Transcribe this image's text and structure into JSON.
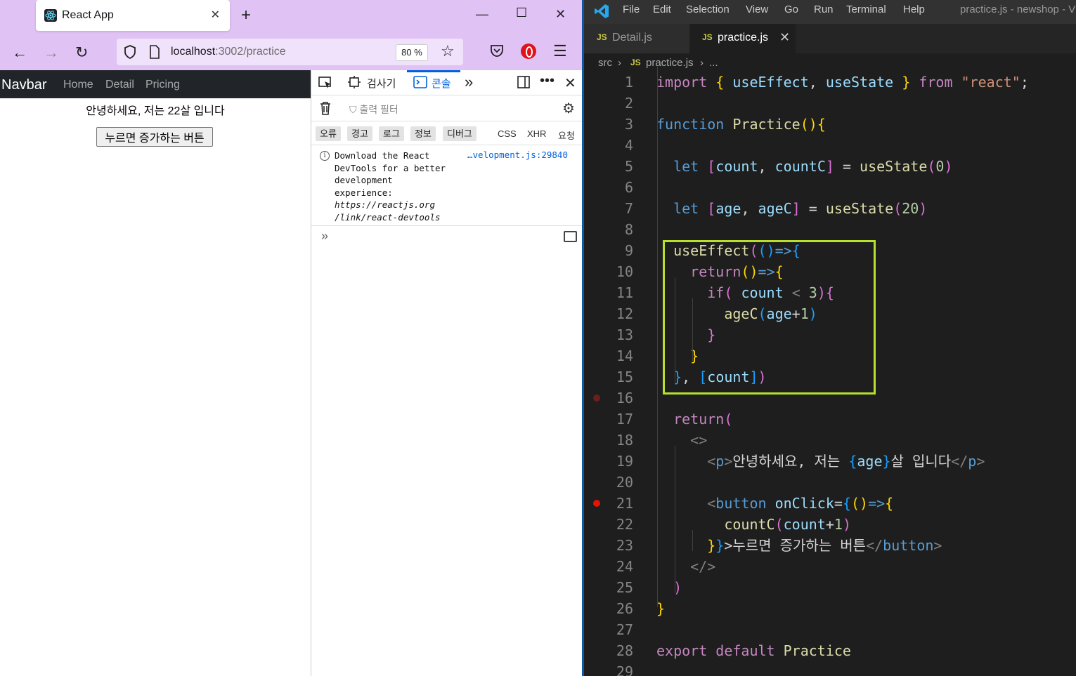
{
  "browser": {
    "tab_title": "React App",
    "url_host": "localhost",
    "url_rest": ":3002/practice",
    "zoom": "80 %"
  },
  "app": {
    "brand": "Navbar",
    "nav_links": [
      "Home",
      "Detail",
      "Pricing"
    ],
    "greeting": "안녕하세요, 저는 22살 입니다",
    "button_label": "누르면 증가하는 버튼"
  },
  "devtools": {
    "tabs": [
      "검사기",
      "콘솔"
    ],
    "filter_placeholder": "출력 필터",
    "levels": [
      "오류",
      "경고",
      "로그",
      "정보",
      "디버그"
    ],
    "extra_filters": [
      "CSS",
      "XHR",
      "요청"
    ],
    "message_lines": [
      "Download the React",
      "DevTools for a better",
      "development",
      "experience:",
      "https://reactjs.org",
      "/link/react-devtools"
    ],
    "message_source": "…velopment.js:29840"
  },
  "vscode": {
    "menu": [
      "File",
      "Edit",
      "Selection",
      "View",
      "Go",
      "Run",
      "Terminal",
      "Help"
    ],
    "window_title": "practice.js - newshop - Vi",
    "tabs": [
      {
        "icon": "JS",
        "name": "Detail.js"
      },
      {
        "icon": "JS",
        "name": "practice.js"
      }
    ],
    "breadcrumb": [
      "src",
      "JS",
      "practice.js",
      "..."
    ],
    "code_lines": [
      "import { useEffect, useState } from \"react\";",
      "",
      "function Practice(){",
      "",
      "  let [count, countC] = useState(0)",
      "",
      "  let [age, ageC] = useState(20)",
      "",
      "  useEffect(()=>{",
      "    return()=>{",
      "      if( count < 3){",
      "        ageC(age+1)",
      "      }",
      "    }",
      "  }, [count])",
      "",
      "  return(",
      "    <>",
      "      <p>안녕하세요, 저는 {age}살 입니다</p>",
      "",
      "      <button onClick={()=>{",
      "        countC(count+1)",
      "      }}>누르면 증가하는 버튼</button>",
      "    </>",
      "  )",
      "}",
      "",
      "export default Practice",
      ""
    ]
  }
}
